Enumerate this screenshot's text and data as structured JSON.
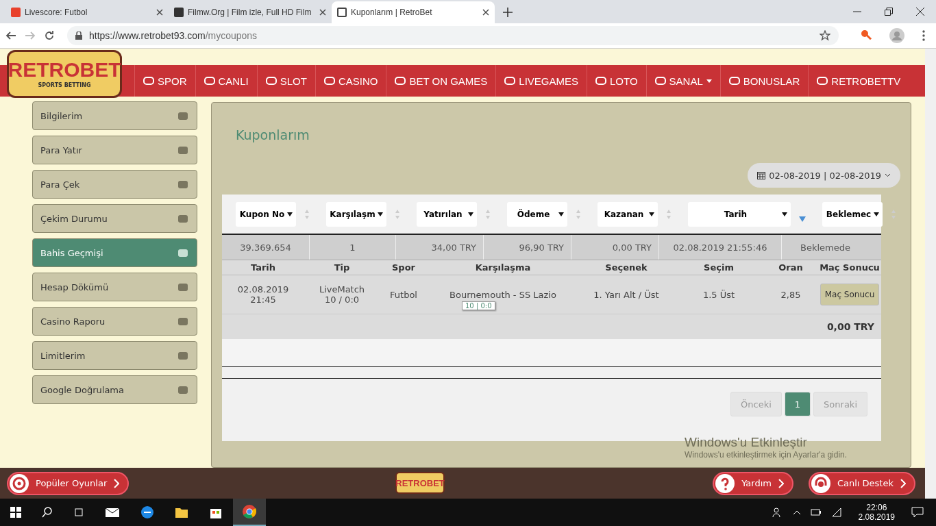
{
  "browser": {
    "tabs": [
      {
        "title": "Livescore: Futbol",
        "selected": false
      },
      {
        "title": "Filmw.Org | Film izle, Full HD Film",
        "selected": false
      },
      {
        "title": "Kuponlarım | RetroBet",
        "selected": true
      }
    ],
    "url_host": "https://www.retrobet93.com",
    "url_path": "/mycoupons"
  },
  "logo": {
    "name": "RETROBET",
    "tagline": "SPORTS BETTING"
  },
  "nav": [
    {
      "label": "SPOR",
      "dropdown": false
    },
    {
      "label": "CANLI",
      "dropdown": false
    },
    {
      "label": "SLOT",
      "dropdown": false
    },
    {
      "label": "CASINO",
      "dropdown": false
    },
    {
      "label": "BET ON GAMES",
      "dropdown": false
    },
    {
      "label": "LIVEGAMES",
      "dropdown": false
    },
    {
      "label": "LOTO",
      "dropdown": false
    },
    {
      "label": "SANAL",
      "dropdown": true
    },
    {
      "label": "BONUSLAR",
      "dropdown": false
    },
    {
      "label": "RETROBETTV",
      "dropdown": false
    }
  ],
  "sidebar": {
    "items": [
      {
        "label": "Bilgilerim",
        "selected": false
      },
      {
        "label": "Para Yatır",
        "selected": false
      },
      {
        "label": "Para Çek",
        "selected": false
      },
      {
        "label": "Çekim Durumu",
        "selected": false
      },
      {
        "label": "Bahis Geçmişi",
        "selected": true
      },
      {
        "label": "Hesap Dökümü",
        "selected": false
      },
      {
        "label": "Casino Raporu",
        "selected": false
      },
      {
        "label": "Limitlerim",
        "selected": false
      },
      {
        "label": "Google Doğrulama",
        "selected": false
      }
    ]
  },
  "page_title": "Kuponlarım",
  "date_range": "02-08-2019 | 02-08-2019",
  "filters": [
    {
      "label": "Kupon No",
      "sorted": false
    },
    {
      "label": "Karşılaşm",
      "sorted": false
    },
    {
      "label": "Yatırılan",
      "sorted": false
    },
    {
      "label": "Ödeme",
      "sorted": false
    },
    {
      "label": "Kazanan",
      "sorted": false
    },
    {
      "label": "Tarih",
      "sorted": true
    },
    {
      "label": "Beklemec",
      "sorted": false
    }
  ],
  "coupon_row": [
    "39.369.654",
    "1",
    "34,00 TRY",
    "96,90 TRY",
    "0,00 TRY",
    "02.08.2019 21:55:46",
    "Beklemede"
  ],
  "detail_columns": [
    "Tarih",
    "Tip",
    "Spor",
    "Karşılaşma",
    "Seçenek",
    "Seçim",
    "Oran",
    "Maç Sonucu"
  ],
  "detail_row": {
    "date": "02.08.2019 21:45",
    "type": "LiveMatch 10 / 0:0",
    "sport": "Futbol",
    "match": "Bournemouth - SS Lazio",
    "option": "1. Yarı Alt / Üst",
    "choice": "1.5 Üst",
    "odds": "2,85",
    "button": "Maç Sonucu"
  },
  "tooltip": "10 | 0:0",
  "total": "0,00 TRY",
  "pagination": [
    {
      "label": "Önceki",
      "kind": "nav",
      "disabled": true
    },
    {
      "label": "1",
      "kind": "page",
      "selected": true
    },
    {
      "label": "Sonraki",
      "kind": "nav",
      "disabled": true
    }
  ],
  "activation": {
    "title": "Windows'u Etkinleştir",
    "text": "Windows'u etkinleştirmek için Ayarlar'a gidin."
  },
  "footer": {
    "left": "Popüler Oyunlar",
    "logo": "RETROBET",
    "help": "Yardım",
    "support": "Canlı Destek"
  },
  "taskbar": {
    "time": "22:06",
    "date": "2.08.2019"
  }
}
